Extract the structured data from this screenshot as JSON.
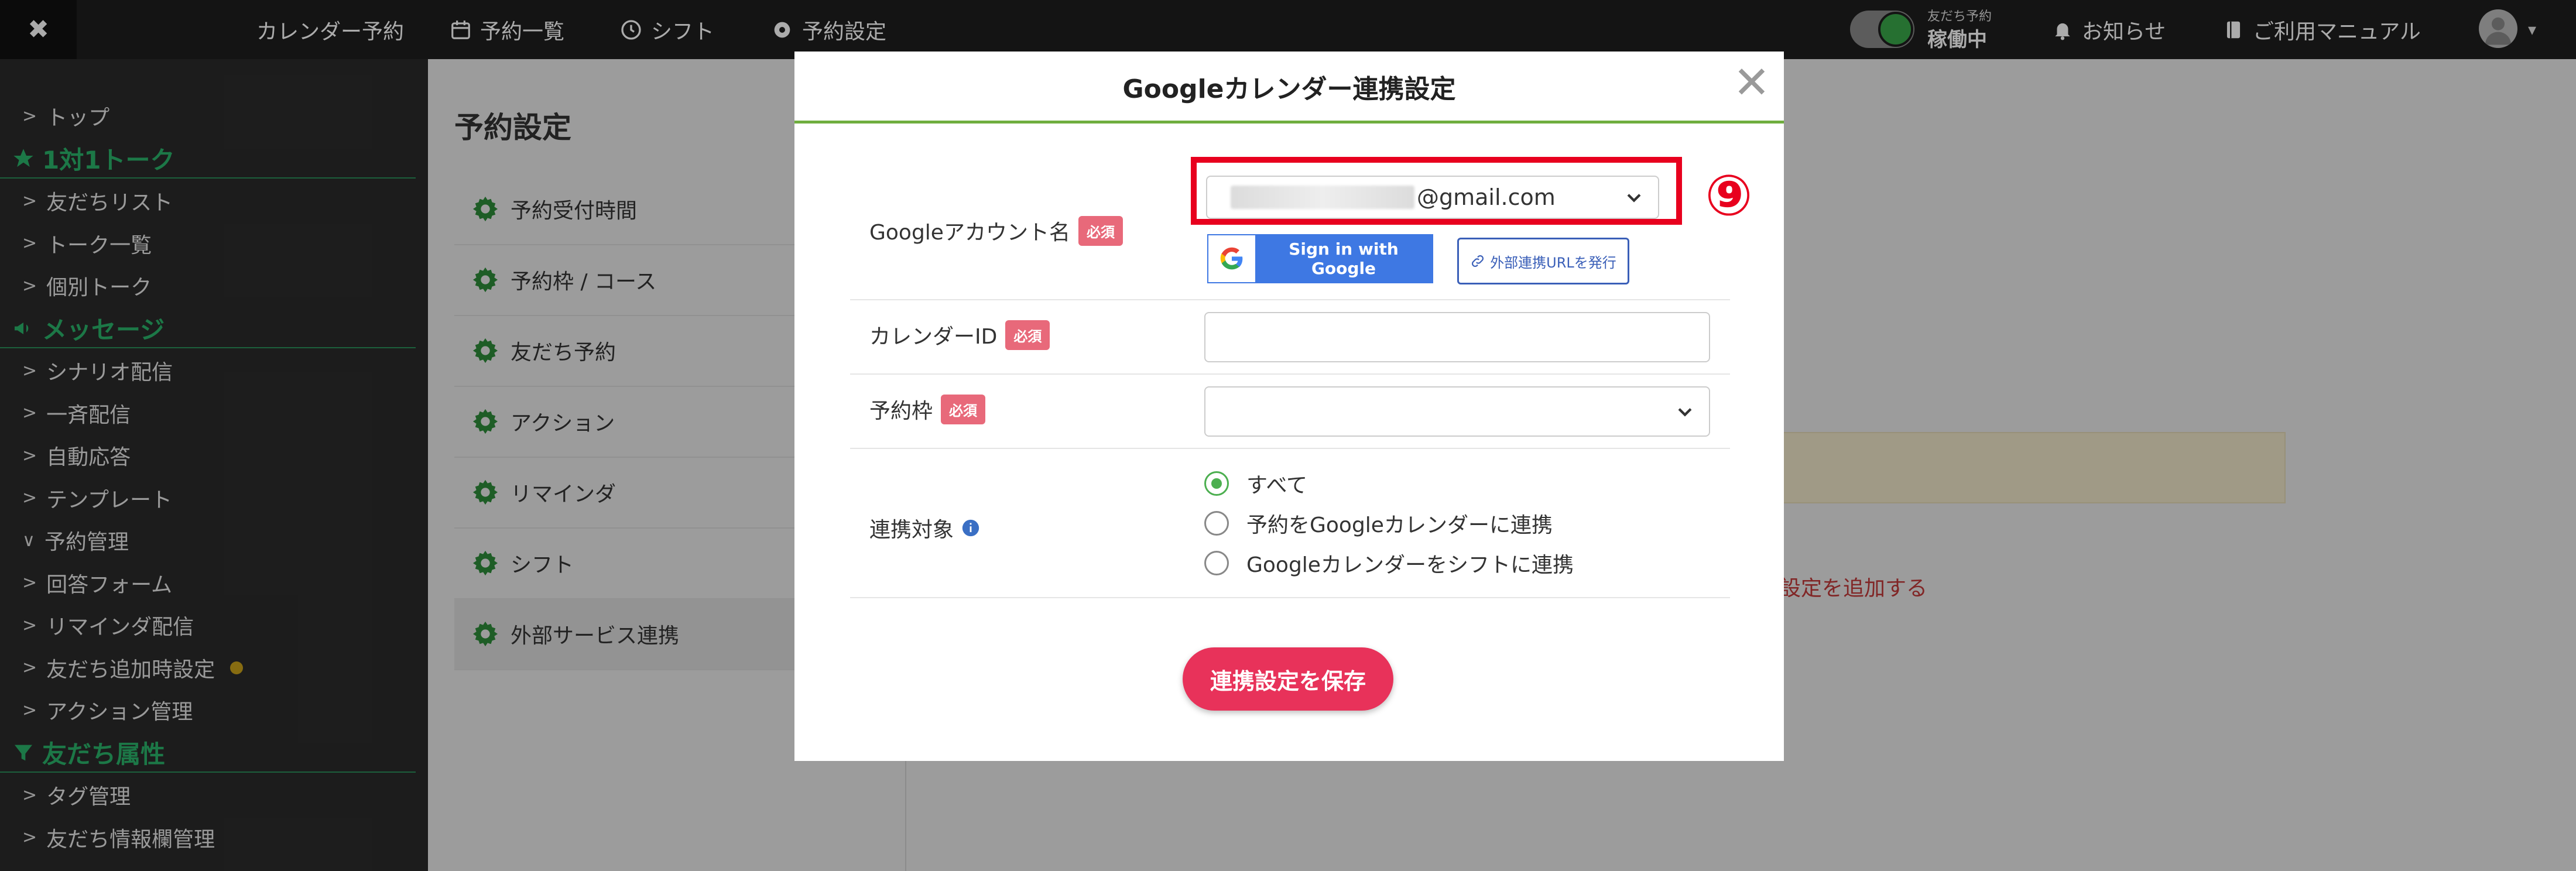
{
  "topbar": {
    "close": "✖",
    "nav": [
      "カレンダー予約",
      "予約一覧",
      "シフト",
      "予約設定"
    ],
    "toggle_small": "友だち予約",
    "toggle_status": "稼働中",
    "notice": "お知らせ",
    "manual": "ご利用マニュアル"
  },
  "sidebar": {
    "items": [
      {
        "type": "link",
        "label": "トップ",
        "chev": ">"
      },
      {
        "type": "section",
        "label": "1対1トーク"
      },
      {
        "type": "link",
        "label": "友だちリスト",
        "chev": ">"
      },
      {
        "type": "link",
        "label": "トーク一覧",
        "chev": ">"
      },
      {
        "type": "link",
        "label": "個別トーク",
        "chev": ">"
      },
      {
        "type": "section",
        "label": "メッセージ"
      },
      {
        "type": "link",
        "label": "シナリオ配信",
        "chev": ">"
      },
      {
        "type": "link",
        "label": "一斉配信",
        "chev": ">"
      },
      {
        "type": "link",
        "label": "自動応答",
        "chev": ">"
      },
      {
        "type": "link",
        "label": "テンプレート",
        "chev": ">"
      },
      {
        "type": "link",
        "label": "予約管理",
        "chev": "∨"
      },
      {
        "type": "link",
        "label": "回答フォーム",
        "chev": ">"
      },
      {
        "type": "link",
        "label": "リマインダ配信",
        "chev": ">"
      },
      {
        "type": "link",
        "label": "友だち追加時設定",
        "chev": ">"
      },
      {
        "type": "link",
        "label": "アクション管理",
        "chev": ">"
      },
      {
        "type": "section",
        "label": "友だち属性"
      },
      {
        "type": "link",
        "label": "タグ管理",
        "chev": ">"
      },
      {
        "type": "link",
        "label": "友だち情報欄管理",
        "chev": ">"
      }
    ]
  },
  "content": {
    "title": "予約設定",
    "settings": [
      "予約受付時間",
      "予約枠 / コース",
      "友だち予約",
      "アクション",
      "リマインダ",
      "シフト",
      "外部サービス連携"
    ],
    "add_link": "設定を追加する"
  },
  "modal": {
    "title": "Googleカレンダー連携設定",
    "close": "✕",
    "required": "必須",
    "google_account_label": "Googleアカウント名",
    "email_domain": "@gmail.com",
    "sign_in": "Sign in with Google",
    "ext_url": "外部連携URLを発行",
    "calendar_id_label": "カレンダーID",
    "calendar_id_value": "",
    "reservation_label": "予約枠",
    "target_label": "連携対象",
    "radios": [
      "すべて",
      "予約をGoogleカレンダーに連携",
      "Googleカレンダーをシフトに連携"
    ],
    "selected_radio": 0,
    "save": "連携設定を保存"
  },
  "annotation": {
    "number": "⑨",
    "color": "#e8001e"
  },
  "colors": {
    "accent": "#6fae3e",
    "save_button": "#e8325a",
    "google_blue": "#3e78e3",
    "sidebar_green": "#2ab36b"
  }
}
